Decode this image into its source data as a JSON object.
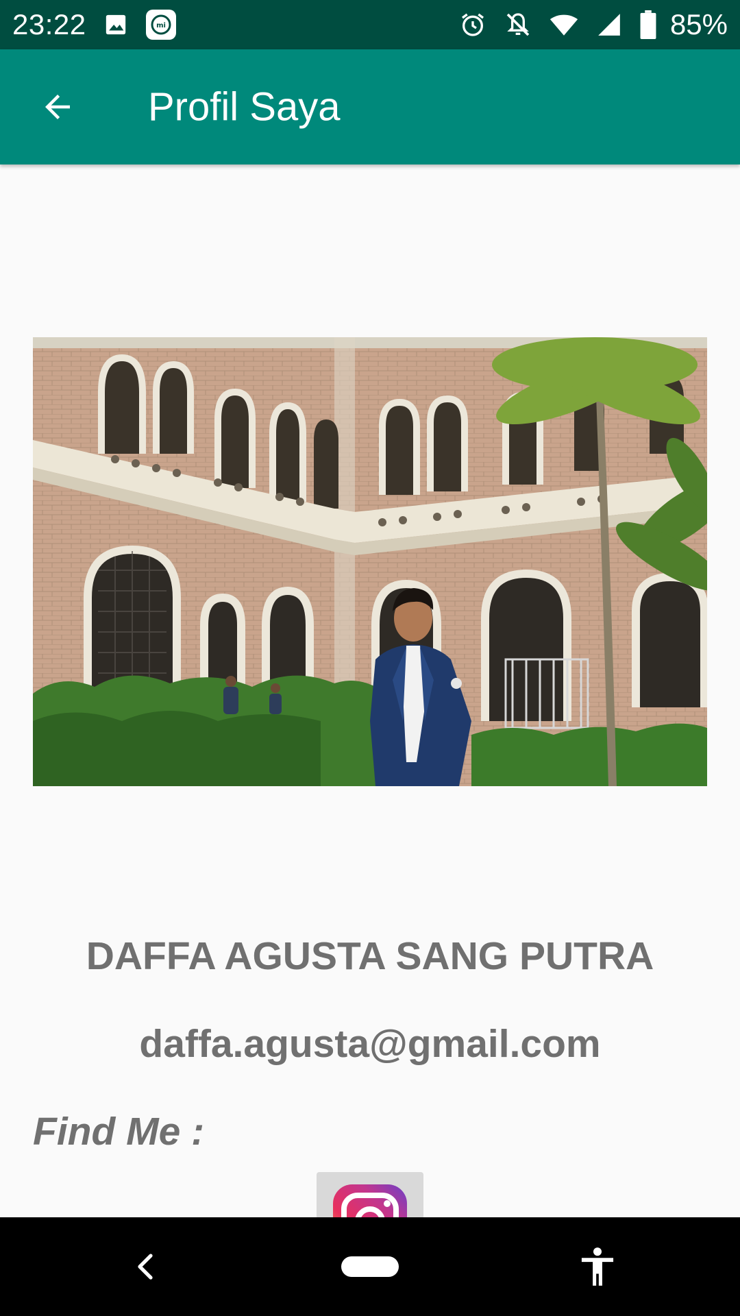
{
  "status_bar": {
    "time": "23:22",
    "battery_percent": "85%",
    "icons": [
      "image-icon",
      "mi-icon",
      "alarm-icon",
      "notifications-off-icon",
      "wifi-icon",
      "signal-icon",
      "battery-icon"
    ]
  },
  "app_bar": {
    "title": "Profil Saya",
    "back_icon": "arrow-back-icon",
    "background_color": "#00897b"
  },
  "profile": {
    "name": "DAFFA AGUSTA SANG PUTRA",
    "email": "daffa.agusta@gmail.com",
    "find_me_label": "Find Me :",
    "photo_description_icon": "profile-photo",
    "social_links": [
      {
        "icon": "instagram-icon"
      }
    ]
  },
  "nav_bar": {
    "icons": [
      "nav-back-icon",
      "home-pill-icon",
      "accessibility-icon"
    ]
  },
  "colors": {
    "status_bar": "#004d40",
    "app_bar": "#00897b",
    "text_gray": "#707070",
    "background": "#fafafa"
  }
}
